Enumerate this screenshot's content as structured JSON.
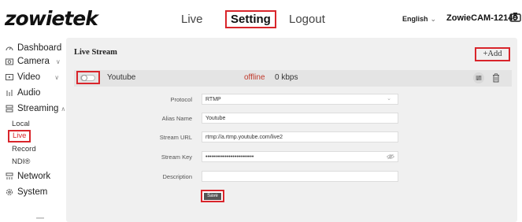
{
  "header": {
    "logo": "zowietek",
    "nav": {
      "live": "Live",
      "setting": "Setting",
      "logout": "Logout"
    },
    "language": "English",
    "device_name": "ZowieCAM-12149"
  },
  "sidebar": {
    "items": [
      {
        "label": "Dashboard",
        "icon": "dashboard-icon"
      },
      {
        "label": "Camera",
        "icon": "camera-icon"
      },
      {
        "label": "Video",
        "icon": "video-icon"
      },
      {
        "label": "Audio",
        "icon": "audio-icon"
      },
      {
        "label": "Streaming",
        "icon": "streaming-icon"
      },
      {
        "label": "Network",
        "icon": "network-icon"
      },
      {
        "label": "System",
        "icon": "system-icon"
      }
    ],
    "streaming_sub": [
      "Local",
      "Live",
      "Record",
      "NDI®"
    ]
  },
  "main": {
    "title": "Live Stream",
    "add_label": "+Add",
    "stream": {
      "name": "Youtube",
      "status": "offline",
      "rate": "0 kbps",
      "enabled": false
    },
    "form": {
      "protocol_label": "Protocol",
      "protocol_value": "RTMP",
      "alias_label": "Alias Name",
      "alias_value": "Youtube",
      "url_label": "Stream URL",
      "url_value": "rtmp://a.rtmp.youtube.com/live2",
      "key_label": "Stream Key",
      "key_value": "•••••••••••••••••••••••••",
      "desc_label": "Description",
      "desc_value": "",
      "save_label": "Save"
    }
  },
  "colors": {
    "accent_red": "#d9252b",
    "status_offline": "#c0392b",
    "panel_bg": "#f0f0f0"
  }
}
